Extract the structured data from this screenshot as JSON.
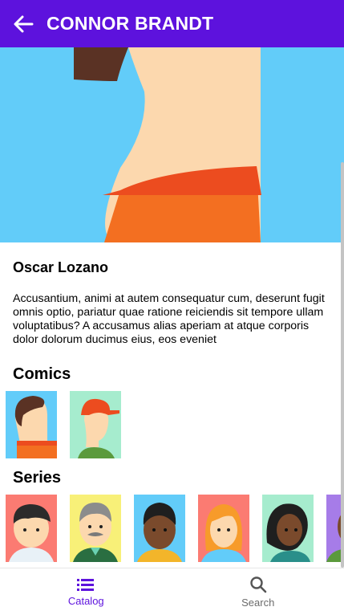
{
  "header": {
    "title": "CONNOR BRANDT"
  },
  "profile": {
    "name": "Oscar Lozano",
    "description": "Accusantium, animi at autem consequatur cum, deserunt fugit omnis optio, pariatur quae ratione reiciendis sit tempore ullam voluptatibus? A accusamus alias aperiam at atque corporis dolor dolorum ducimus eius, eos eveniet"
  },
  "sections": {
    "comics_title": "Comics",
    "series_title": "Series"
  },
  "bottom_nav": [
    {
      "label": "Catalog",
      "icon": "list-icon",
      "active": true
    },
    {
      "label": "Search",
      "icon": "search-icon",
      "active": false
    }
  ],
  "colors": {
    "primary": "#5d12dd",
    "hero_background": "#62ccf9"
  }
}
